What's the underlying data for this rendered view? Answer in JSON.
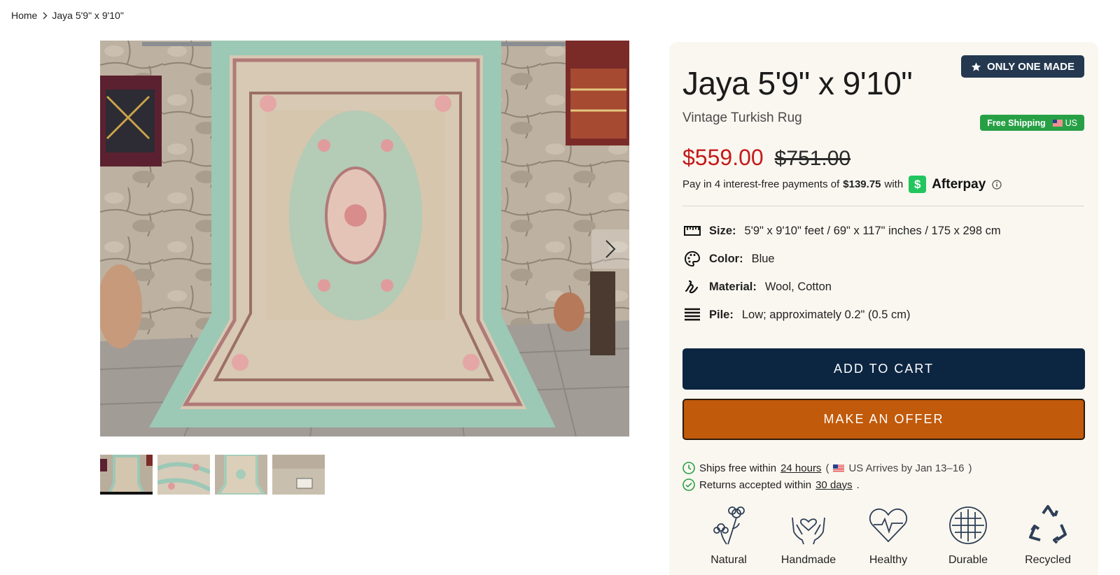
{
  "breadcrumb": {
    "home": "Home",
    "current": "Jaya 5'9\" x 9'10\""
  },
  "product": {
    "title": "Jaya 5'9\" x 9'10\"",
    "subtitle": "Vintage Turkish Rug",
    "badge": "ONLY ONE MADE",
    "shipping_badge": {
      "text": "Free Shipping",
      "region": "US"
    },
    "price_sale": "$559.00",
    "price_original": "$751.00",
    "afterpay": {
      "prefix": "Pay in 4 interest-free payments of",
      "amount": "$139.75",
      "with": "with",
      "logo_glyph": "$",
      "brand": "Afterpay"
    }
  },
  "specs": [
    {
      "icon": "ruler-icon",
      "label": "Size:",
      "value": "5'9\" x 9'10\" feet / 69\" x 117\" inches / 175 x 298 cm"
    },
    {
      "icon": "palette-icon",
      "label": "Color:",
      "value": "Blue"
    },
    {
      "icon": "yarn-icon",
      "label": "Material:",
      "value": "Wool, Cotton"
    },
    {
      "icon": "pile-icon",
      "label": "Pile:",
      "value": "Low; approximately 0.2\" (0.5 cm)"
    }
  ],
  "actions": {
    "add_to_cart": "ADD TO CART",
    "make_offer": "MAKE AN OFFER"
  },
  "shipping": {
    "ships_prefix": "Ships free within",
    "ships_link": "24 hours",
    "paren_open": "(",
    "arrival": "US Arrives by Jan 13–16",
    "paren_close": ")",
    "returns_prefix": "Returns accepted within",
    "returns_link": "30 days",
    "returns_suffix": "."
  },
  "features": [
    {
      "icon": "flower-icon",
      "label": "Natural"
    },
    {
      "icon": "hands-heart-icon",
      "label": "Handmade"
    },
    {
      "icon": "heartbeat-icon",
      "label": "Healthy"
    },
    {
      "icon": "weave-icon",
      "label": "Durable"
    },
    {
      "icon": "recycle-icon",
      "label": "Recycled"
    }
  ],
  "colors": {
    "navy": "#0c2642",
    "orange": "#c15a0a",
    "sale_red": "#c41a1a",
    "badge_navy": "#24384f",
    "ship_green": "#27a045",
    "panel_bg": "#faf7f0"
  }
}
